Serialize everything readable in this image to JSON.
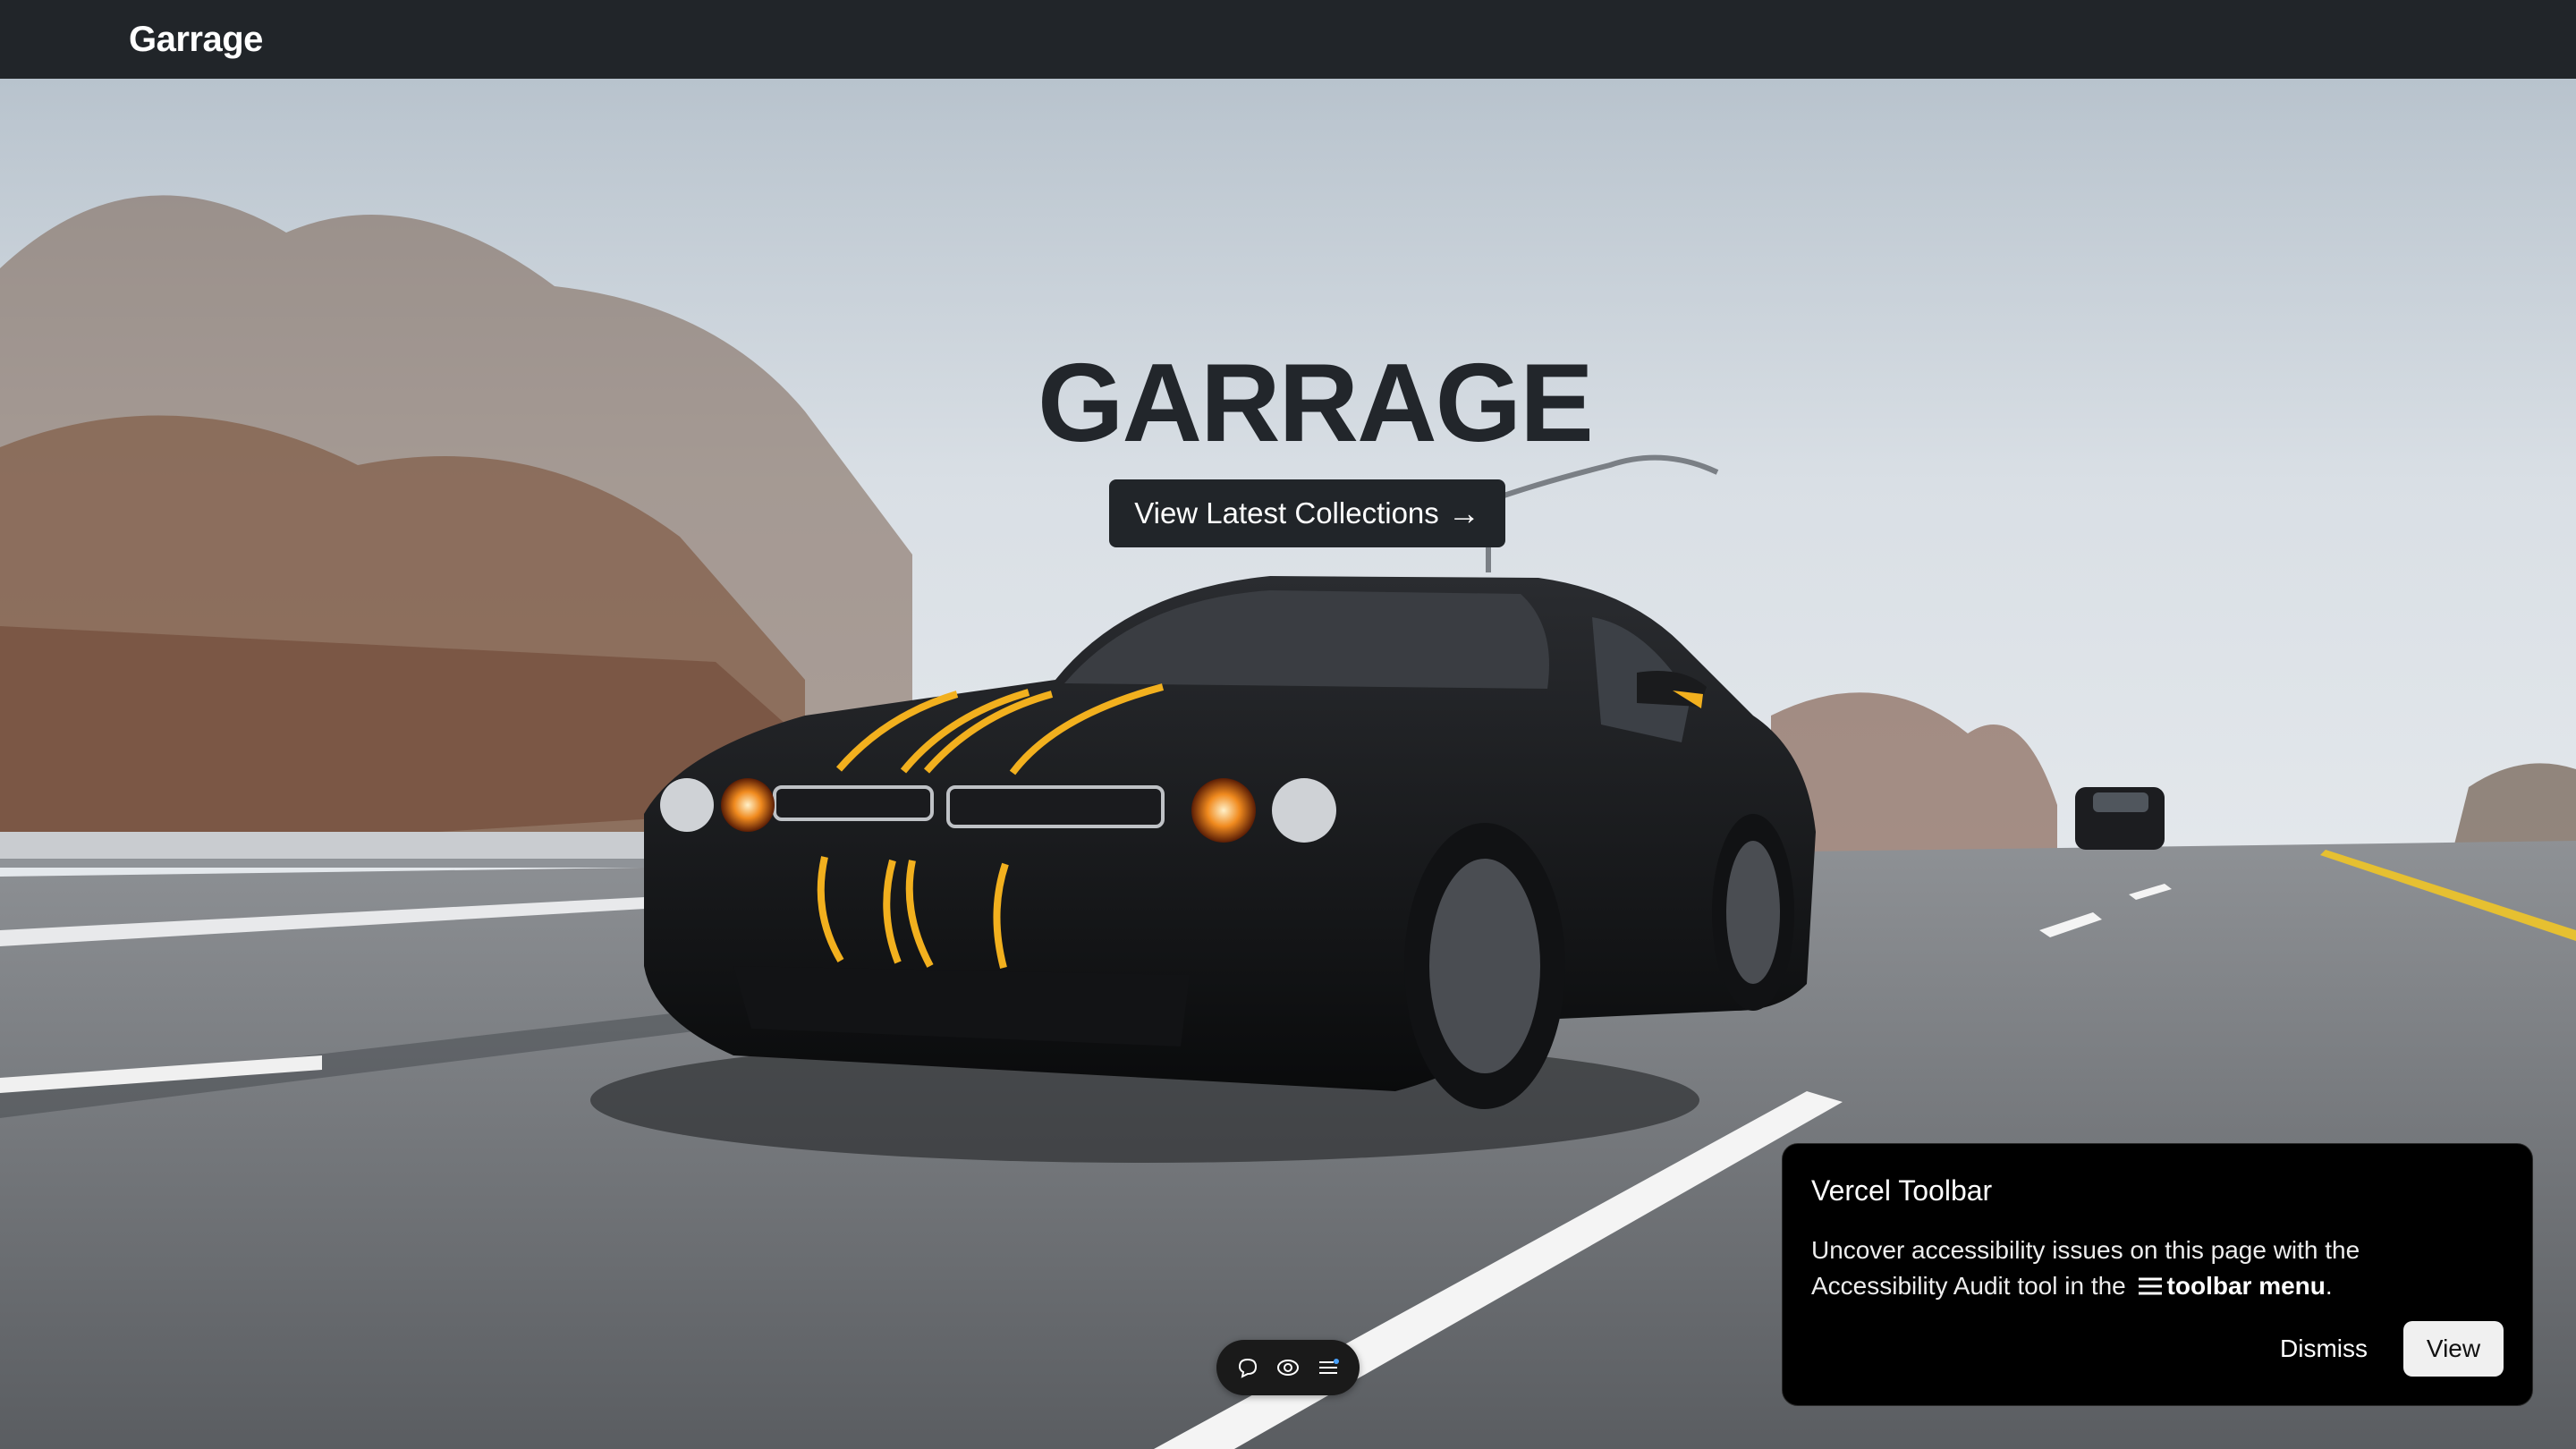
{
  "navbar": {
    "brand": "Garrage"
  },
  "hero": {
    "headline": "GARRAGE",
    "cta_label": "View Latest Collections",
    "cta_arrow": "→",
    "image_icon": "car-hero-photo"
  },
  "mini_toolbar": {
    "icons": [
      "comment-icon",
      "eye-icon",
      "menu-icon"
    ]
  },
  "toast": {
    "title": "Vercel Toolbar",
    "body_prefix": "Uncover accessibility issues on this page with the Accessibility Audit tool in the",
    "body_bold": "toolbar menu",
    "body_suffix": ".",
    "dismiss_label": "Dismiss",
    "view_label": "View"
  },
  "colors": {
    "navbar_bg": "#212529",
    "cta_bg": "#212529",
    "toast_bg": "#000000",
    "stripe_accent": "#f2b01e"
  }
}
